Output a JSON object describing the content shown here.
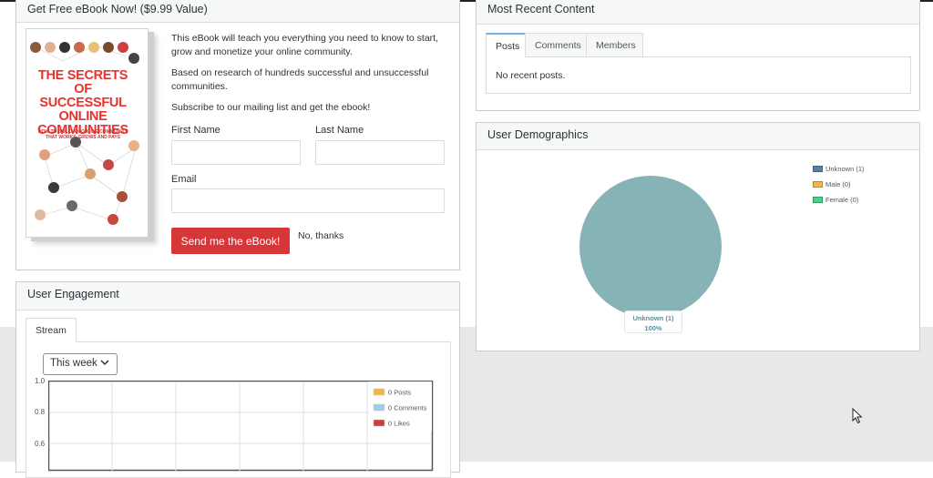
{
  "ebook": {
    "title": "Get Free eBook Now! ($9.99 Value)",
    "book_title": "THE SECRETS OF SUCCESSFUL ONLINE COMMUNITIES",
    "book_subtitle": "HOW TO BUILD AN ONLINE COMMUNITY THAT WORKS, GROWS AND PAYS",
    "para1": "This eBook will teach you everything you need to know to start, grow and monetize your online community.",
    "para2": "Based on research of hundreds successful and unsuccessful communities.",
    "para3": "Subscribe to our mailing list and get the ebook!",
    "first_name_label": "First Name",
    "last_name_label": "Last Name",
    "email_label": "Email",
    "first_name_value": "",
    "last_name_value": "",
    "email_value": "",
    "send_button": "Send me the eBook!",
    "no_thanks": "No, thanks"
  },
  "engagement": {
    "title": "User Engagement",
    "tab": "Stream",
    "period": "This week",
    "legend": [
      {
        "label": "0 Posts",
        "color": "#f0b849"
      },
      {
        "label": "0 Comments",
        "color": "#a4c8e8"
      },
      {
        "label": "0 Likes",
        "color": "#d03c3c"
      }
    ],
    "y_ticks": [
      "1.0",
      "0.8",
      "0.6"
    ]
  },
  "recent": {
    "title": "Most Recent Content",
    "tabs": [
      "Posts",
      "Comments",
      "Members"
    ],
    "active_tab": "Posts",
    "empty_text": "No recent posts."
  },
  "demographics": {
    "title": "User Demographics",
    "legend": [
      {
        "label": "Unknown (1)",
        "color": "#5b7fa3"
      },
      {
        "label": "Male (0)",
        "color": "#f0b849"
      },
      {
        "label": "Female (0)",
        "color": "#4ccf8a"
      }
    ],
    "pie_color": "#86b3b6",
    "slice_label": "Unknown (1)",
    "slice_percent": "100%"
  },
  "chart_data": {
    "type": "pie",
    "categories": [
      "Unknown (1)",
      "Male (0)",
      "Female (0)"
    ],
    "values": [
      1,
      0,
      0
    ]
  }
}
